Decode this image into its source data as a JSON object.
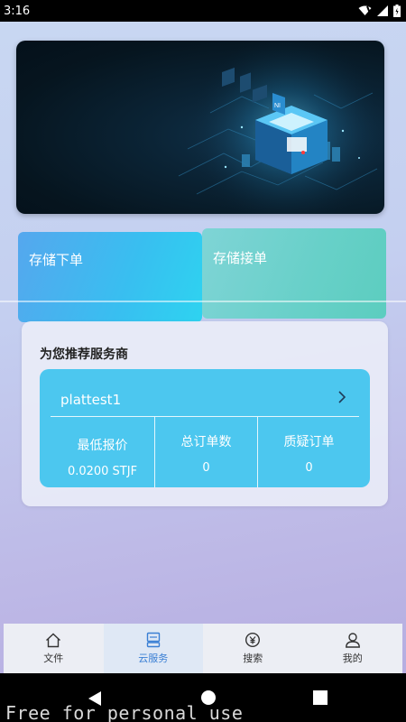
{
  "status_bar": {
    "time": "3:16",
    "icons": [
      "wifi-icon",
      "signal-icon",
      "battery-icon"
    ]
  },
  "banner": {
    "chip_label": "NI"
  },
  "storage": {
    "order_label": "存储下单",
    "take_label": "存储接单"
  },
  "recommend": {
    "title": "为您推荐服务商",
    "provider": {
      "name": "plattest1",
      "stats": [
        {
          "label": "最低报价",
          "value": "0.0200 STJF"
        },
        {
          "label": "总订单数",
          "value": "0"
        },
        {
          "label": "质疑订单",
          "value": "0"
        }
      ]
    }
  },
  "bottom_nav": {
    "items": [
      {
        "label": "文件",
        "icon": "home-icon",
        "active": false
      },
      {
        "label": "云服务",
        "icon": "cloud-server-icon",
        "active": true
      },
      {
        "label": "搜索",
        "icon": "yuan-search-icon",
        "active": false
      },
      {
        "label": "我的",
        "icon": "user-icon",
        "active": false
      }
    ]
  },
  "colors": {
    "accent": "#3a7fd4",
    "provider_card": "#4cc7ef",
    "order_card": "#38bff0",
    "take_card": "#67d0c8"
  },
  "watermark": "Free for personal use"
}
